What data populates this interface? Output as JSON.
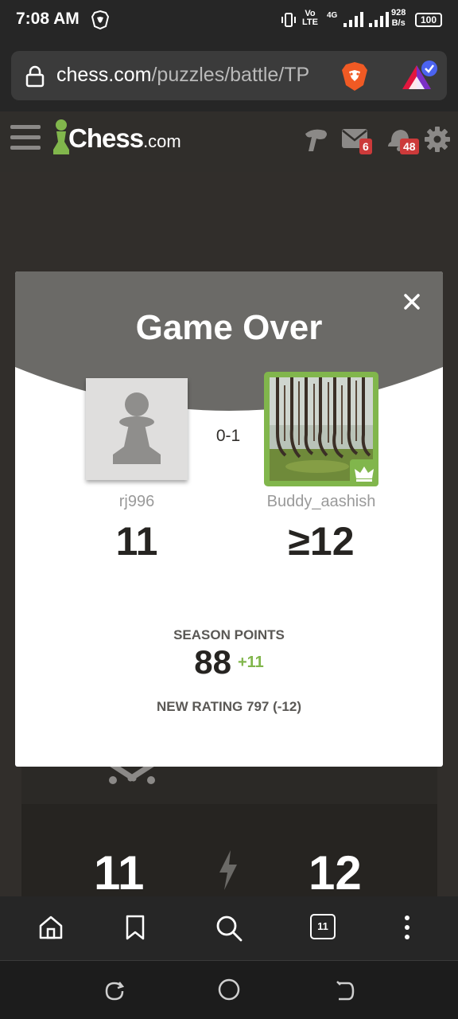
{
  "status_bar": {
    "time": "7:08 AM",
    "volte_top": "Vo",
    "volte_bottom": "LTE",
    "network": "4G",
    "speed_value": "928",
    "speed_unit": "B/s",
    "battery": "100",
    "icons": [
      "brave-icon",
      "vibrate-icon",
      "signal-icon",
      "signal-icon"
    ]
  },
  "browser": {
    "url_domain": "chess.com",
    "url_path": "/puzzles/battle/TP",
    "icons": [
      "lock-icon",
      "brave-shield-icon",
      "brave-rewards-icon"
    ]
  },
  "site_header": {
    "logo_text": "Chess",
    "logo_suffix": ".com",
    "icons": [
      "hamburger-icon",
      "puzzle-icon",
      "mail-icon",
      "bell-icon",
      "gear-icon"
    ],
    "mail_count": "6",
    "notification_count": "48"
  },
  "modal": {
    "title": "Game Over",
    "result": "0-1",
    "player_left": {
      "name": "rj996",
      "score": "11"
    },
    "player_right": {
      "name": "Buddy_aashish",
      "score": "≥12"
    },
    "season_label": "SEASON POINTS",
    "season_points": "88",
    "season_delta": "+11",
    "new_rating": "NEW RATING 797 (-12)"
  },
  "background_panel": {
    "score_left": "11",
    "score_right": "12",
    "icons": [
      "swords-icon",
      "lightning-icon"
    ]
  },
  "bottom_toolbar": {
    "tab_count": "11",
    "icons": [
      "home-icon",
      "bookmark-icon",
      "search-icon",
      "tabs-icon",
      "menu-icon"
    ]
  },
  "nav_bar": {
    "icons": [
      "recent-apps-icon",
      "home-circle-icon",
      "back-icon"
    ]
  },
  "colors": {
    "accent_green": "#81b64c",
    "badge_red": "#cc3a3a",
    "header_gray": "#6b6a67",
    "page_background": "#312e2b"
  }
}
